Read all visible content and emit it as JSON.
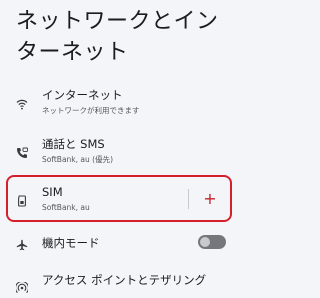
{
  "page": {
    "title": "ネットワークとインターネット"
  },
  "items": {
    "internet": {
      "icon": "wifi-icon",
      "title": "インターネット",
      "subtitle": "ネットワークが利用できます"
    },
    "calls_sms": {
      "icon": "phone-icon",
      "title": "通話と SMS",
      "subtitle": "SoftBank, au (優先)"
    },
    "sim": {
      "icon": "sim-card-icon",
      "title": "SIM",
      "subtitle": "SoftBank, au",
      "add_label": "+"
    },
    "airplane": {
      "icon": "airplane-icon",
      "title": "機内モード",
      "enabled": false
    },
    "hotspot": {
      "icon": "hotspot-icon",
      "title": "アクセス ポイントとテザリング"
    }
  },
  "colors": {
    "background": "#f4f5f8",
    "highlight": "#d5202b",
    "accent": "#c6212c",
    "toggle_off": "#76777c"
  }
}
